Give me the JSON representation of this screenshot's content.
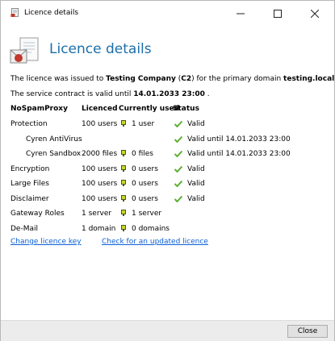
{
  "window": {
    "title": "Licence details",
    "heading": "Licence details",
    "close_label": "Close"
  },
  "summary": {
    "issued_prefix": "The licence was issued to ",
    "company": "Testing Company",
    "code_open": " (",
    "code": "C2",
    "code_close": ")",
    "domain_text": " for the primary domain ",
    "domain": "testing.local",
    "issued_suffix": " .",
    "valid_prefix": "The service contract is valid until ",
    "valid_date": "14.01.2033 23:00",
    "valid_suffix": " ."
  },
  "table": {
    "headers": [
      "NoSpamProxy",
      "Licenced",
      "Currently used",
      "Status"
    ],
    "rows": [
      {
        "name": "Protection",
        "licenced": "100 users",
        "used": "1 user",
        "status": "Valid"
      },
      {
        "name": "Cyren AntiVirus",
        "licenced": "",
        "used": "",
        "status": "Valid until 14.01.2033 23:00"
      },
      {
        "name": "Cyren Sandbox",
        "licenced": "2000 files",
        "used": "0 files",
        "status": "Valid until 14.01.2033 23:00"
      },
      {
        "name": "Encryption",
        "licenced": "100 users",
        "used": "0 users",
        "status": "Valid"
      },
      {
        "name": "Large Files",
        "licenced": "100 users",
        "used": "0 users",
        "status": "Valid"
      },
      {
        "name": "Disclaimer",
        "licenced": "100 users",
        "used": "0 users",
        "status": "Valid"
      },
      {
        "name": "Gateway Roles",
        "licenced": "1 server",
        "used": "1 server",
        "status": ""
      },
      {
        "name": "De-Mail",
        "licenced": "1 domain",
        "used": "0 domains",
        "status": ""
      }
    ]
  },
  "links": {
    "change": "Change licence key",
    "check": "Check for an updated licence"
  },
  "colors": {
    "heading": "#1b6ea8",
    "link": "#0b5fd6",
    "check": "#5cb032",
    "plug": "#c8d62a"
  }
}
